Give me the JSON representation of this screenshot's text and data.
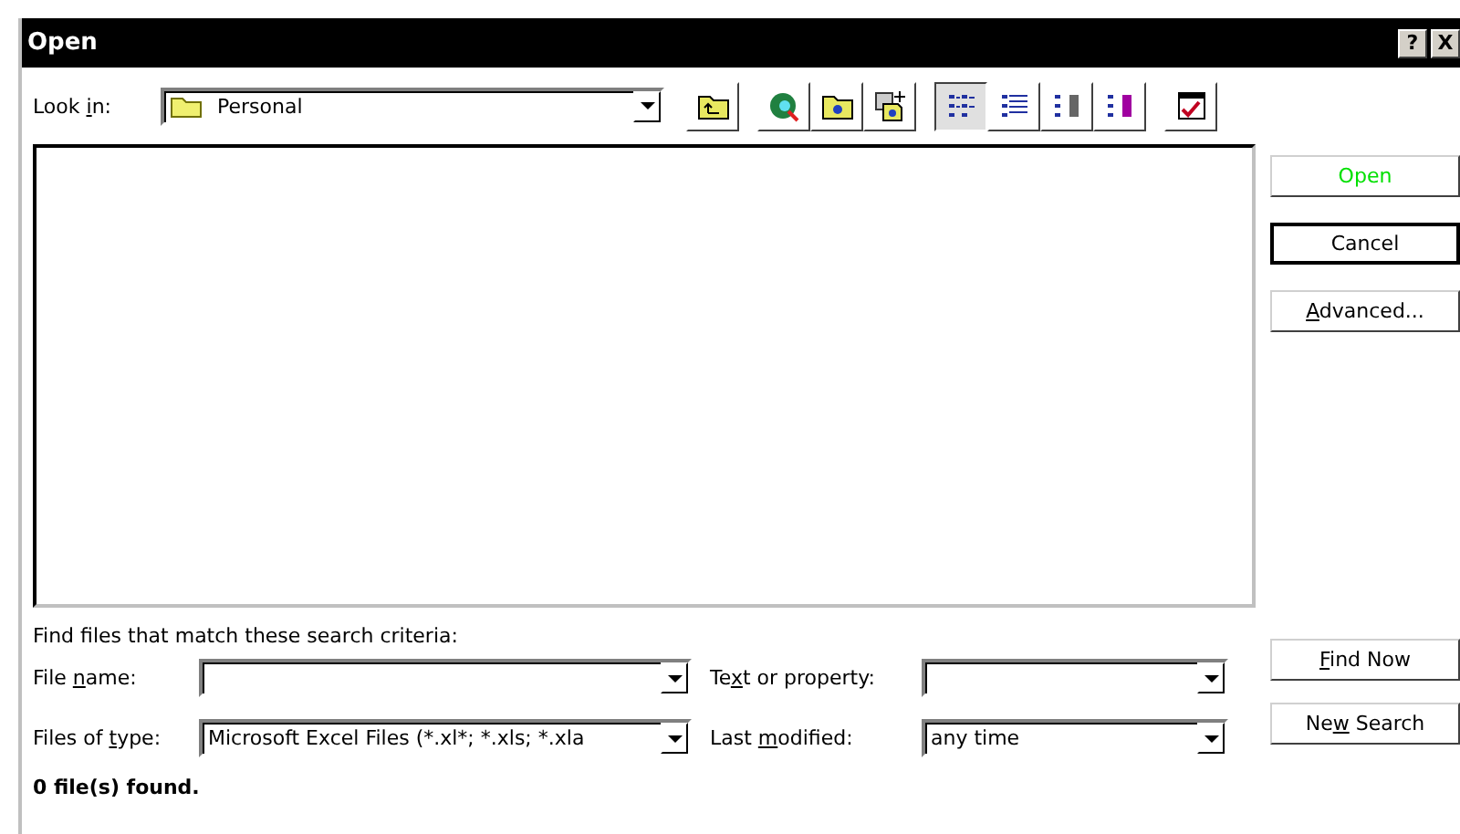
{
  "window": {
    "title": "Open",
    "controls": [
      "?",
      "X"
    ]
  },
  "look_in": {
    "label": {
      "pre": "Look ",
      "key": "i",
      "post": "n:"
    },
    "value": "Personal"
  },
  "toolbar": [
    [
      {
        "kind": "up-folder"
      }
    ],
    [
      {
        "kind": "web"
      },
      {
        "kind": "new-folder"
      },
      {
        "kind": "favorite"
      }
    ],
    [
      {
        "kind": "list-view",
        "selected": true
      },
      {
        "kind": "details-view",
        "selected": false
      },
      {
        "kind": "properties-view",
        "selected": false
      },
      {
        "kind": "preview-view",
        "selected": false
      }
    ],
    [
      {
        "kind": "commands"
      }
    ]
  ],
  "side_buttons": [
    {
      "label": {
        "pre": "Open"
      },
      "color": "#00e000",
      "default": false
    },
    {
      "label": {
        "pre": "Cancel"
      },
      "color": "#000000",
      "default": true
    },
    {
      "label": {
        "key": "A",
        "post": "dvanced..."
      },
      "color": "#000000",
      "default": false
    }
  ],
  "search": {
    "heading": "Find files that match these search criteria:",
    "rows": [
      {
        "label": {
          "pre": "File ",
          "key": "n",
          "post": "ame:"
        },
        "label2": {
          "pre": "Te",
          "key": "x",
          "post": "t or property:"
        },
        "button": {
          "key": "F",
          "post": "ind Now"
        }
      },
      {
        "label": {
          "pre": "Files of ",
          "key": "t",
          "post": "ype:"
        },
        "value": "Microsoft Excel Files (*.xl*; *.xls; *.xla",
        "label2": {
          "pre": "Last ",
          "key": "m",
          "post": "odified:"
        },
        "value2": "any time",
        "button": {
          "pre": "Ne",
          "key": "w",
          "post": " Search"
        }
      }
    ]
  },
  "status": "0 file(s) found."
}
